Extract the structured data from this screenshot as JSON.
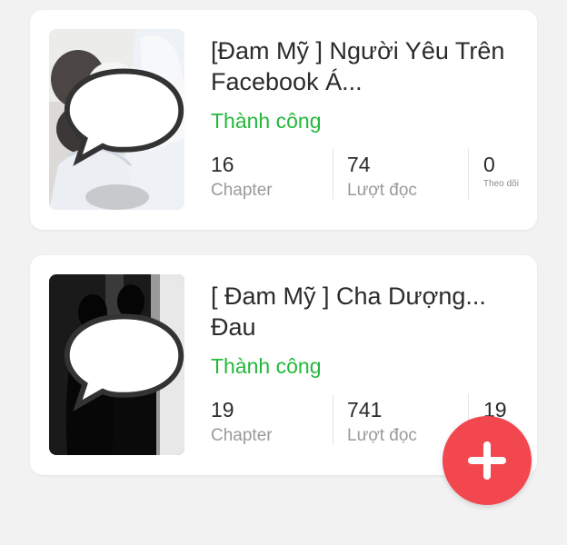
{
  "stories": [
    {
      "title": "[Đam Mỹ ] Người Yêu Trên Facebook Á...",
      "status": "Thành công",
      "chapters": "16",
      "chapters_label": "Chapter",
      "reads": "74",
      "reads_label": "Lượt đọc",
      "follows": "0",
      "follows_label": "Theo dõi"
    },
    {
      "title": "[ Đam Mỹ ] Cha Dượng... Đau",
      "status": "Thành công",
      "chapters": "19",
      "chapters_label": "Chapter",
      "reads": "741",
      "reads_label": "Lượt đọc",
      "follows": "19",
      "follows_label": ""
    }
  ],
  "fab": {
    "icon": "plus-icon"
  },
  "colors": {
    "status": "#25b83c",
    "fab": "#f2474f",
    "background": "#f2f2f2"
  }
}
